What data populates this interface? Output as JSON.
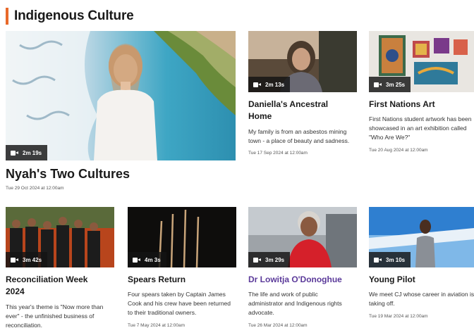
{
  "section": {
    "title": "Indigenous Culture",
    "accent": "#e8692a"
  },
  "featured": {
    "title": "Nyah's Two Cultures",
    "duration": "2m 19s",
    "date": "Tue 29 Oct 2024 at 12:00am"
  },
  "top_cards": [
    {
      "title_line1": "Daniella's Ancestral",
      "title_line2": "Home",
      "duration": "2m 13s",
      "desc_line1": "My family is from an asbestos mining",
      "desc_line2": "town - a place of beauty and sadness.",
      "date": "Tue 17 Sep 2024 at 12:00am"
    },
    {
      "title_line1": "First Nations Art",
      "duration": "3m 25s",
      "desc_line1": "First Nations student artwork has been",
      "desc_line2": "showcased in an art exhibition called",
      "desc_line3": "\"Who Are We?\"",
      "date": "Tue 20 Aug 2024 at 12:00am"
    }
  ],
  "bottom_cards": [
    {
      "title_line1": "Reconciliation Week",
      "title_line2": "2024",
      "duration": "3m 42s",
      "desc_line1": "This year's theme is \"Now more than",
      "desc_line2": "ever\" - the unfinished business of",
      "desc_line3": "reconciliation."
    },
    {
      "title_line1": "Spears Return",
      "duration": "4m 3s",
      "desc_line1": "Four spears taken by Captain James",
      "desc_line2": "Cook and his crew have been returned",
      "desc_line3": "to their traditional owners.",
      "date": "Tue 7 May 2024 at 12:00am"
    },
    {
      "title_line1": "Dr Lowitja O'Donoghue",
      "duration": "3m 29s",
      "desc_line1": "The life and work of public",
      "desc_line2": "administrator and Indigenous rights",
      "desc_line3": "advocate.",
      "date": "Tue 26 Mar 2024 at 12:00am"
    },
    {
      "title_line1": "Young Pilot",
      "duration": "3m 10s",
      "desc_line1": "We meet CJ whose career in aviation is",
      "desc_line2": "taking off.",
      "date": "Tue 19 Mar 2024 at 12:00am"
    }
  ]
}
